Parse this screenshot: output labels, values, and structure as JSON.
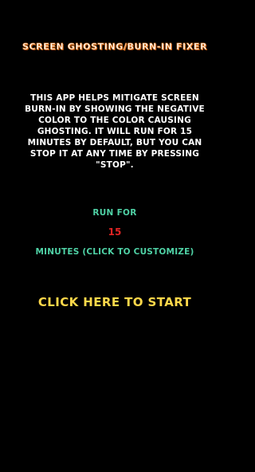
{
  "app": {
    "title": "SCREEN GHOSTING/BURN-IN FIXER",
    "description": "THIS APP HELPS MITIGATE SCREEN BURN-IN BY SHOWING THE NEGATIVE COLOR TO THE COLOR CAUSING GHOSTING. IT WILL RUN FOR 15 MINUTES BY DEFAULT, BUT YOU CAN STOP IT AT ANY TIME BY PRESSING \"STOP\"."
  },
  "timer": {
    "run_for_label": "RUN FOR",
    "minutes_value": "15",
    "minutes_hint": "MINUTES (CLICK TO CUSTOMIZE)"
  },
  "actions": {
    "start_label": "CLICK HERE TO START"
  },
  "colors": {
    "background": "#000000",
    "title_outline": "#e0781f",
    "body_text": "#ffffff",
    "accent_teal": "#4fd1a5",
    "minutes_red": "#e02424",
    "start_yellow": "#ffd84a"
  }
}
